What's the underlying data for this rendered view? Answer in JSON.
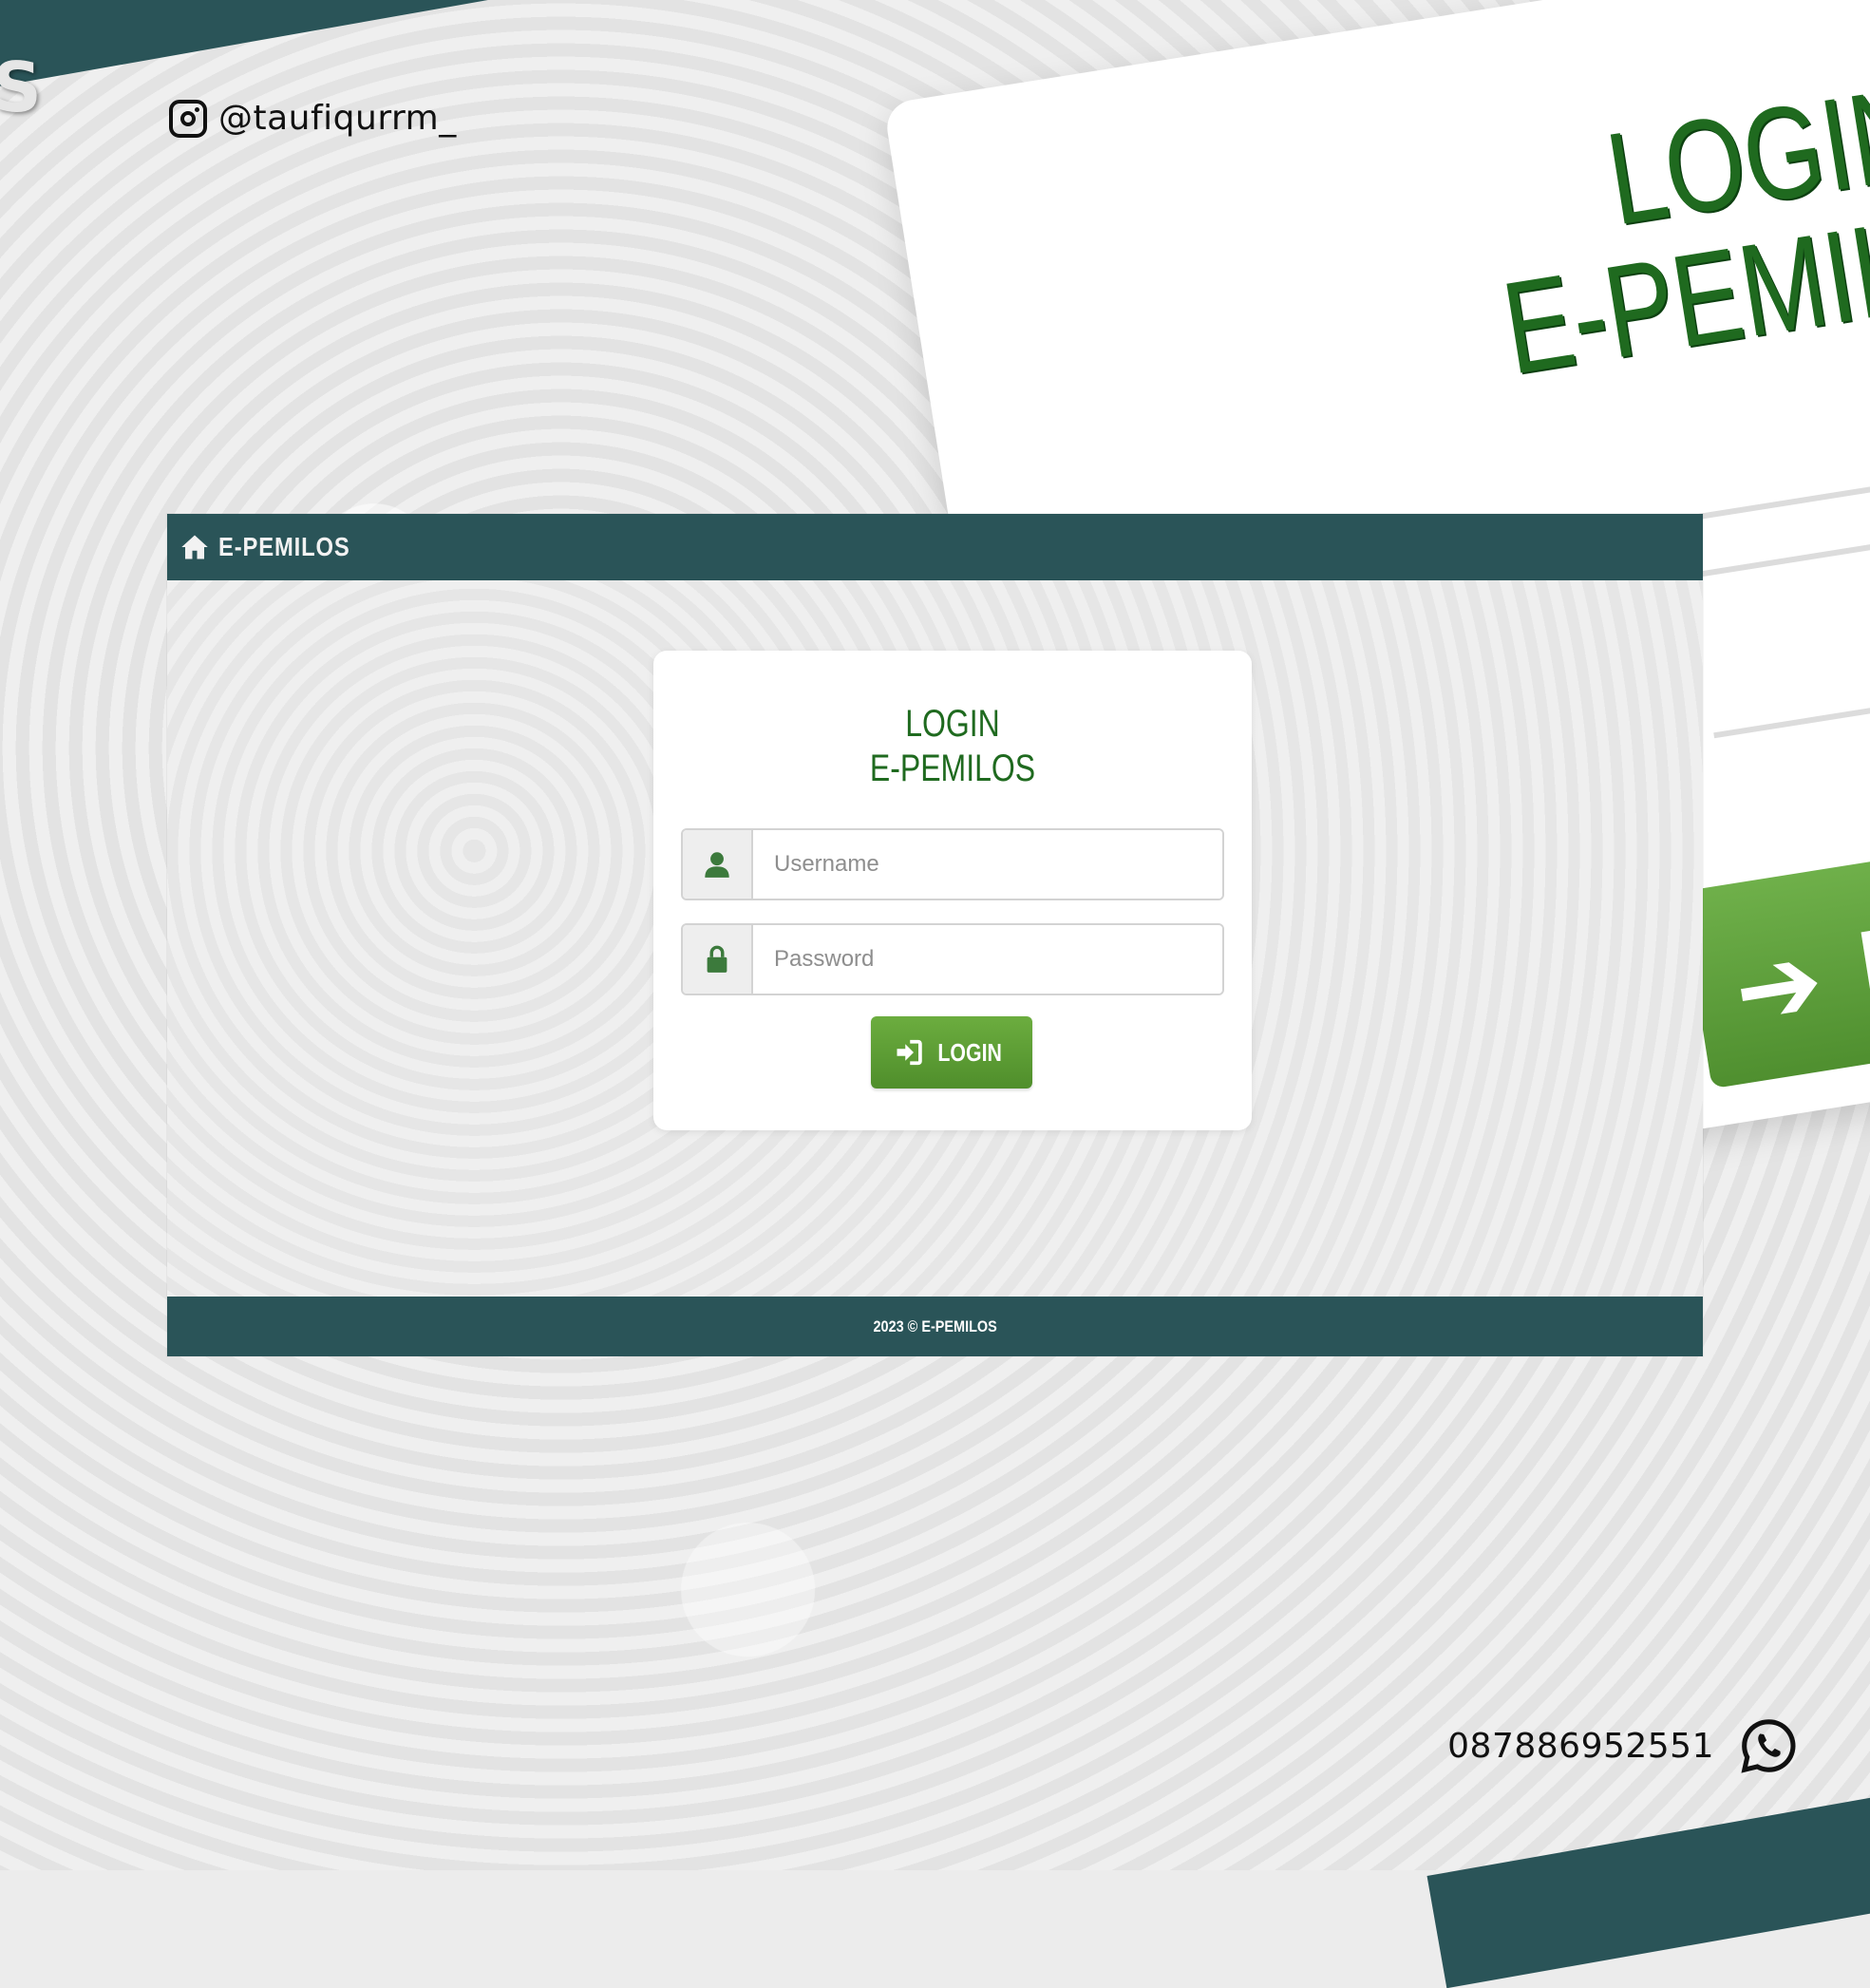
{
  "social": {
    "instagram_handle": "@taufiqurrm_",
    "whatsapp_number": "087886952551"
  },
  "background_echo": {
    "banner_letter": "S",
    "title_line1": "LOGIN",
    "title_line2": "E-PEMILO",
    "button_text": "L"
  },
  "navbar": {
    "brand": "E-PEMILOS"
  },
  "login": {
    "title_line1": "LOGIN",
    "title_line2": "E-PEMILOS",
    "username_placeholder": "Username",
    "password_placeholder": "Password",
    "button_label": "LOGIN"
  },
  "footer": {
    "text": "2023 © E-PEMILOS"
  },
  "colors": {
    "primary": "#2a5458",
    "accent_green": "#1f6a1f",
    "button_green": "#5e9e36"
  }
}
